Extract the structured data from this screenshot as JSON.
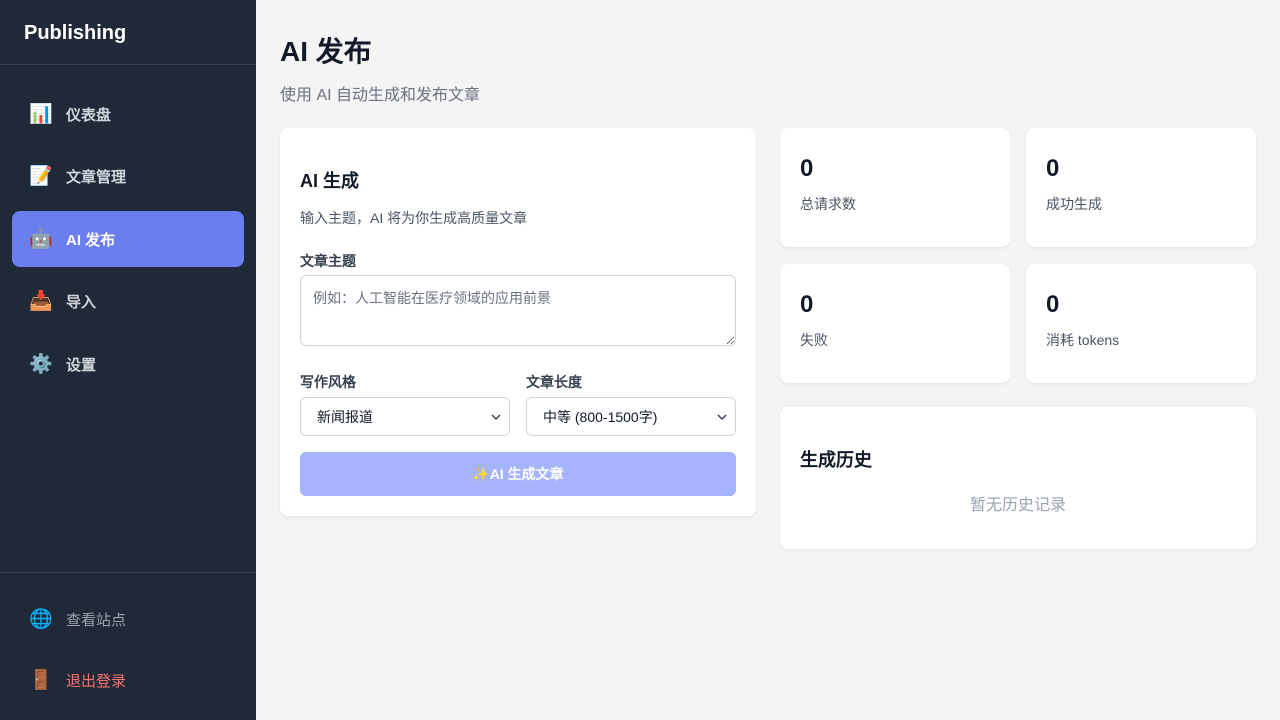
{
  "sidebar": {
    "brand": "Publishing",
    "items": [
      {
        "label": "仪表盘",
        "icon": "bar-chart-icon",
        "glyph": "📊"
      },
      {
        "label": "文章管理",
        "icon": "memo-icon",
        "glyph": "📝"
      },
      {
        "label": "AI 发布",
        "icon": "robot-icon",
        "glyph": "🤖",
        "active": true
      },
      {
        "label": "导入",
        "icon": "inbox-tray-icon",
        "glyph": "📥"
      },
      {
        "label": "设置",
        "icon": "gear-icon",
        "glyph": "⚙️"
      }
    ],
    "bottom": [
      {
        "label": "查看站点",
        "icon": "globe-icon",
        "glyph": "🌐"
      },
      {
        "label": "退出登录",
        "icon": "door-icon",
        "glyph": "🚪"
      }
    ]
  },
  "header": {
    "title": "AI 发布",
    "subtitle": "使用 AI 自动生成和发布文章"
  },
  "generator": {
    "title": "AI 生成",
    "description": "输入主题，AI 将为你生成高质量文章",
    "topic_label": "文章主题",
    "topic_placeholder": "例如：人工智能在医疗领域的应用前景",
    "style_label": "写作风格",
    "style_value": "新闻报道",
    "length_label": "文章长度",
    "length_value": "中等 (800-1500字)",
    "button_label": "✨AI 生成文章"
  },
  "stats": [
    {
      "value": "0",
      "label": "总请求数"
    },
    {
      "value": "0",
      "label": "成功生成"
    },
    {
      "value": "0",
      "label": "失败"
    },
    {
      "value": "0",
      "label": "消耗 tokens"
    }
  ],
  "history": {
    "title": "生成历史",
    "empty_text": "暂无历史记录"
  },
  "colors": {
    "sidebar_bg": "#1f2937",
    "accent": "#6b7ef0",
    "button_disabled": "#a5b4fc",
    "danger": "#f87171"
  }
}
